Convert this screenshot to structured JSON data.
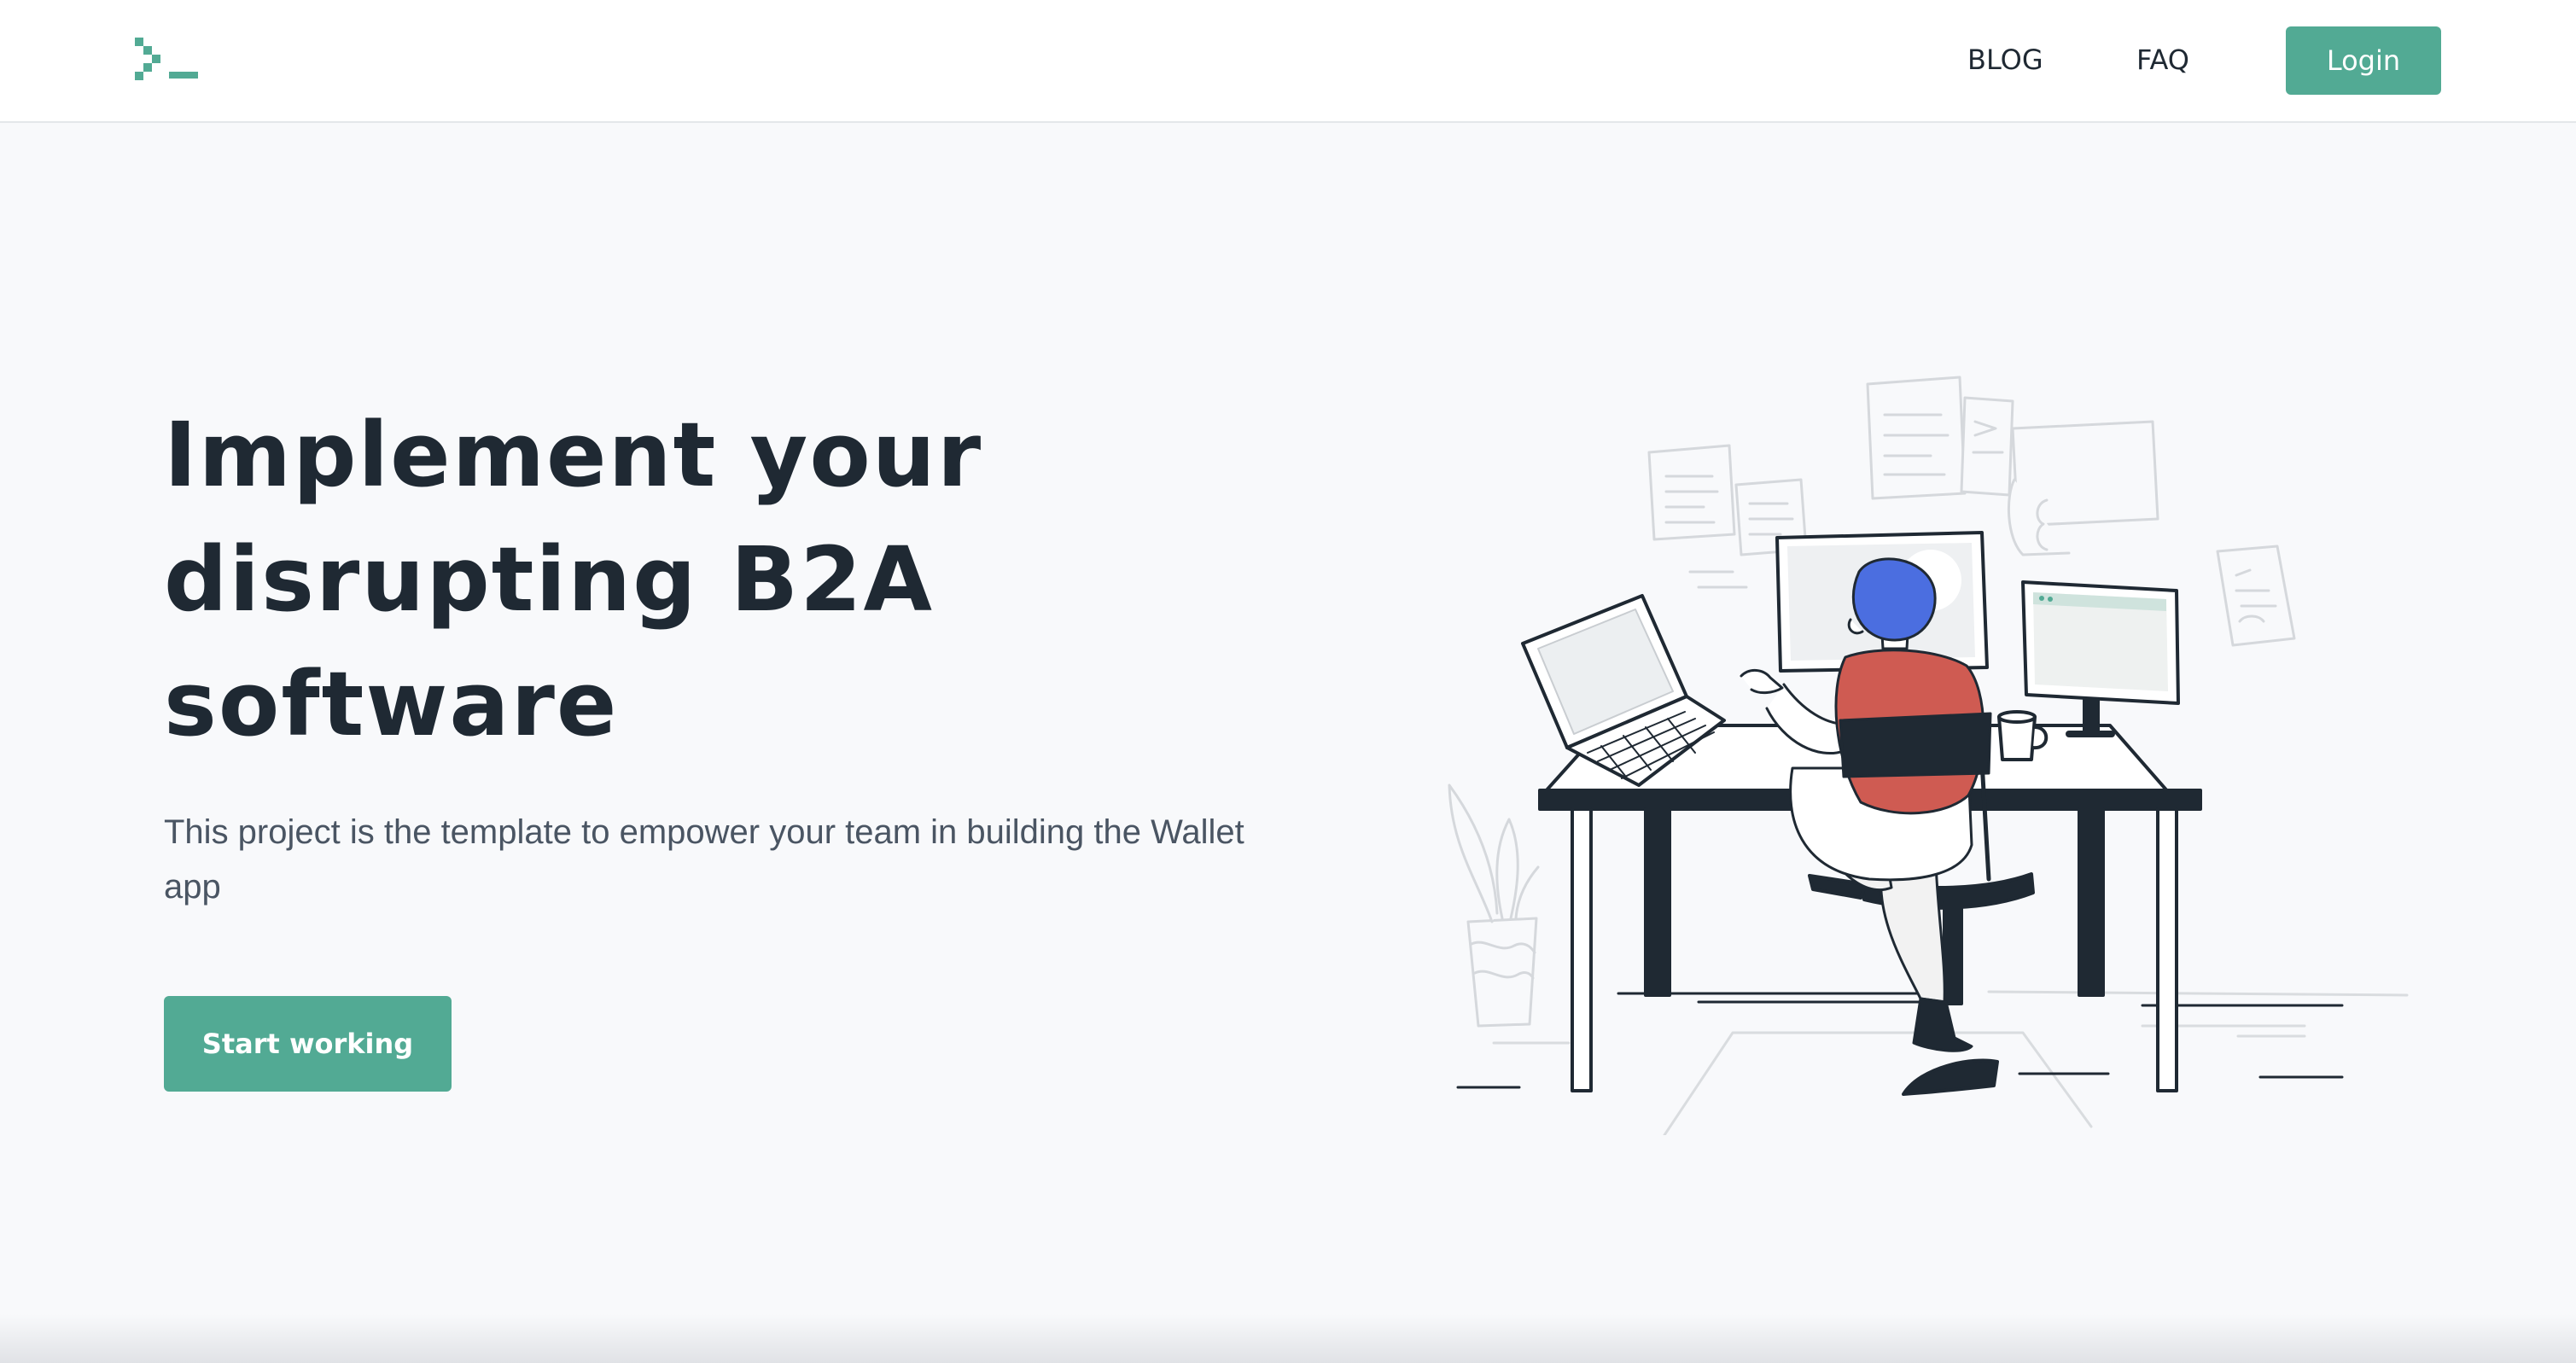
{
  "header": {
    "nav": {
      "blog_label": "BLOG",
      "faq_label": "FAQ"
    },
    "login_label": "Login"
  },
  "hero": {
    "title": "Implement your disrupting B2A software",
    "subtitle": "This project is the template to empower your team in building the Wallet app",
    "cta_label": "Start working"
  },
  "icons": {
    "logo": "terminal-prompt-logo-icon",
    "illustration": "developer-at-desk-illustration"
  },
  "colors": {
    "accent": "#52aa94",
    "background": "#f8f9fb",
    "header_background": "#ffffff",
    "text_dark": "#1f2933",
    "text_muted": "#4a5563",
    "illustration_hair": "#4b6ee0",
    "illustration_shirt": "#cf5b52"
  }
}
